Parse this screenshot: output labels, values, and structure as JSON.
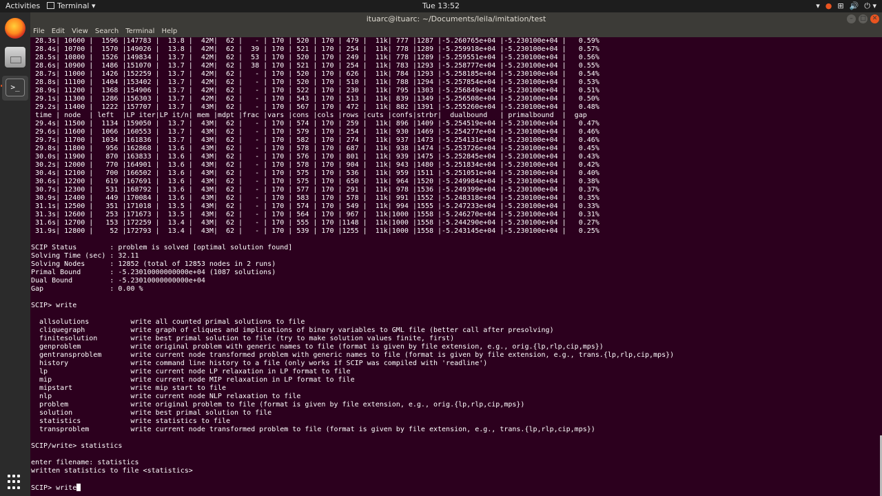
{
  "topbar": {
    "activities": "Activities",
    "app_menu": "Terminal ▾",
    "clock": "Tue 13:52",
    "tray": [
      "▾",
      "●",
      "⊞",
      "🔊",
      "⏻ ▾"
    ]
  },
  "dock": {
    "apps": [
      "firefox",
      "files",
      "terminal",
      "show-applications"
    ]
  },
  "window": {
    "title": "ituarc@ituarc: ~/Documents/leila/imitation/test",
    "menu": [
      "File",
      "Edit",
      "View",
      "Search",
      "Terminal",
      "Help"
    ]
  },
  "terminal": {
    "lines": [
      " 28.3s| 10600 |  1596 |147783 |  13.8 |  42M|  62 |   - | 170 | 520 | 170 | 479 |  11k| 777 |1287 |-5.260765e+04 |-5.230100e+04 |   0.59%",
      " 28.4s| 10700 |  1570 |149026 |  13.8 |  42M|  62 |  39 | 170 | 521 | 170 | 254 |  11k| 778 |1289 |-5.259918e+04 |-5.230100e+04 |   0.57%",
      " 28.5s| 10800 |  1526 |149834 |  13.7 |  42M|  62 |  53 | 170 | 520 | 170 | 249 |  11k| 778 |1289 |-5.259551e+04 |-5.230100e+04 |   0.56%",
      " 28.6s| 10900 |  1486 |151070 |  13.7 |  42M|  62 |  38 | 170 | 521 | 170 | 254 |  11k| 783 |1293 |-5.258777e+04 |-5.230100e+04 |   0.55%",
      " 28.7s| 11000 |  1426 |152259 |  13.7 |  42M|  62 |   - | 170 | 520 | 170 | 626 |  11k| 784 |1293 |-5.258185e+04 |-5.230100e+04 |   0.54%",
      " 28.8s| 11100 |  1404 |153402 |  13.7 |  42M|  62 |   - | 170 | 520 | 170 | 510 |  11k| 788 |1294 |-5.257854e+04 |-5.230100e+04 |   0.53%",
      " 28.9s| 11200 |  1368 |154906 |  13.7 |  42M|  62 |   - | 170 | 522 | 170 | 230 |  11k| 795 |1303 |-5.256849e+04 |-5.230100e+04 |   0.51%",
      " 29.1s| 11300 |  1286 |156303 |  13.7 |  42M|  62 |   - | 170 | 543 | 170 | 513 |  11k| 839 |1349 |-5.256508e+04 |-5.230100e+04 |   0.50%",
      " 29.2s| 11400 |  1222 |157707 |  13.7 |  43M|  62 |   - | 170 | 567 | 170 | 472 |  11k| 882 |1391 |-5.255260e+04 |-5.230100e+04 |   0.48%",
      " time | node  | left  |LP iter|LP it/n| mem |mdpt |frac |vars |cons |cols |rows |cuts |confs|strbr|  dualbound   | primalbound  |  gap",
      " 29.4s| 11500 |  1134 |159050 |  13.7 |  43M|  62 |   - | 170 | 574 | 170 | 259 |  11k| 896 |1409 |-5.254519e+04 |-5.230100e+04 |   0.47%",
      " 29.6s| 11600 |  1066 |160553 |  13.7 |  43M|  62 |   - | 170 | 579 | 170 | 254 |  11k| 930 |1469 |-5.254277e+04 |-5.230100e+04 |   0.46%",
      " 29.7s| 11700 |  1034 |161836 |  13.7 |  43M|  62 |   - | 170 | 582 | 170 | 274 |  11k| 937 |1473 |-5.254131e+04 |-5.230100e+04 |   0.46%",
      " 29.8s| 11800 |   956 |162868 |  13.6 |  43M|  62 |   - | 170 | 578 | 170 | 687 |  11k| 938 |1474 |-5.253726e+04 |-5.230100e+04 |   0.45%",
      " 30.0s| 11900 |   870 |163833 |  13.6 |  43M|  62 |   - | 170 | 576 | 170 | 801 |  11k| 939 |1475 |-5.252845e+04 |-5.230100e+04 |   0.43%",
      " 30.2s| 12000 |   770 |164901 |  13.6 |  43M|  62 |   - | 170 | 578 | 170 | 904 |  11k| 943 |1480 |-5.251834e+04 |-5.230100e+04 |   0.42%",
      " 30.4s| 12100 |   700 |166502 |  13.6 |  43M|  62 |   - | 170 | 575 | 170 | 536 |  11k| 959 |1511 |-5.251051e+04 |-5.230100e+04 |   0.40%",
      " 30.6s| 12200 |   619 |167691 |  13.6 |  43M|  62 |   - | 170 | 575 | 170 | 650 |  11k| 964 |1520 |-5.249984e+04 |-5.230100e+04 |   0.38%",
      " 30.7s| 12300 |   531 |168792 |  13.6 |  43M|  62 |   - | 170 | 577 | 170 | 291 |  11k| 978 |1536 |-5.249399e+04 |-5.230100e+04 |   0.37%",
      " 30.9s| 12400 |   449 |170084 |  13.6 |  43M|  62 |   - | 170 | 583 | 170 | 578 |  11k| 991 |1552 |-5.248318e+04 |-5.230100e+04 |   0.35%",
      " 31.1s| 12500 |   351 |171018 |  13.5 |  43M|  62 |   - | 170 | 574 | 170 | 549 |  11k| 994 |1555 |-5.247233e+04 |-5.230100e+04 |   0.33%",
      " 31.3s| 12600 |   253 |171673 |  13.5 |  43M|  62 |   - | 170 | 564 | 170 | 967 |  11k|1000 |1558 |-5.246270e+04 |-5.230100e+04 |   0.31%",
      " 31.6s| 12700 |   153 |172259 |  13.4 |  43M|  62 |   - | 170 | 555 | 170 |1148 |  11k|1000 |1558 |-5.244290e+04 |-5.230100e+04 |   0.27%",
      " 31.9s| 12800 |    52 |172793 |  13.4 |  43M|  62 |   - | 170 | 539 | 170 |1255 |  11k|1000 |1558 |-5.243145e+04 |-5.230100e+04 |   0.25%",
      "",
      "SCIP Status        : problem is solved [optimal solution found]",
      "Solving Time (sec) : 32.11",
      "Solving Nodes      : 12852 (total of 12853 nodes in 2 runs)",
      "Primal Bound       : -5.23010000000000e+04 (1087 solutions)",
      "Dual Bound         : -5.23010000000000e+04",
      "Gap                : 0.00 %",
      "",
      "SCIP> write",
      "",
      "  allsolutions          write all counted primal solutions to file",
      "  cliquegraph           write graph of cliques and implications of binary variables to GML file (better call after presolving)",
      "  finitesolution        write best primal solution to file (try to make solution values finite, first)",
      "  genproblem            write original problem with generic names to file (format is given by file extension, e.g., orig.{lp,rlp,cip,mps})",
      "  gentransproblem       write current node transformed problem with generic names to file (format is given by file extension, e.g., trans.{lp,rlp,cip,mps})",
      "  history               write command line history to a file (only works if SCIP was compiled with 'readline')",
      "  lp                    write current node LP relaxation in LP format to file",
      "  mip                   write current node MIP relaxation in LP format to file",
      "  mipstart              write mip start to file",
      "  nlp                   write current node NLP relaxation to file",
      "  problem               write original problem to file (format is given by file extension, e.g., orig.{lp,rlp,cip,mps})",
      "  solution              write best primal solution to file",
      "  statistics            write statistics to file",
      "  transproblem          write current node transformed problem to file (format is given by file extension, e.g., trans.{lp,rlp,cip,mps})",
      "",
      "SCIP/write> statistics",
      "",
      "enter filename: statistics",
      "written statistics to file <statistics>",
      ""
    ],
    "prompt": "SCIP> write"
  }
}
